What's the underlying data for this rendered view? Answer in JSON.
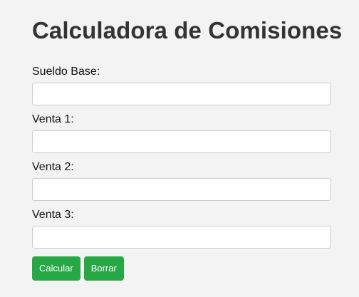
{
  "page": {
    "title": "Calculadora de Comisiones"
  },
  "form": {
    "fields": [
      {
        "label": "Sueldo Base:",
        "value": "",
        "placeholder": ""
      },
      {
        "label": "Venta 1:",
        "value": "",
        "placeholder": ""
      },
      {
        "label": "Venta 2:",
        "value": "",
        "placeholder": ""
      },
      {
        "label": "Venta 3:",
        "value": "",
        "placeholder": ""
      }
    ]
  },
  "buttons": {
    "calculate_label": "Calcular",
    "clear_label": "Borrar"
  },
  "colors": {
    "background": "#f3f3f3",
    "button": "#28a745",
    "button_text": "#ffffff",
    "title": "#333333"
  }
}
